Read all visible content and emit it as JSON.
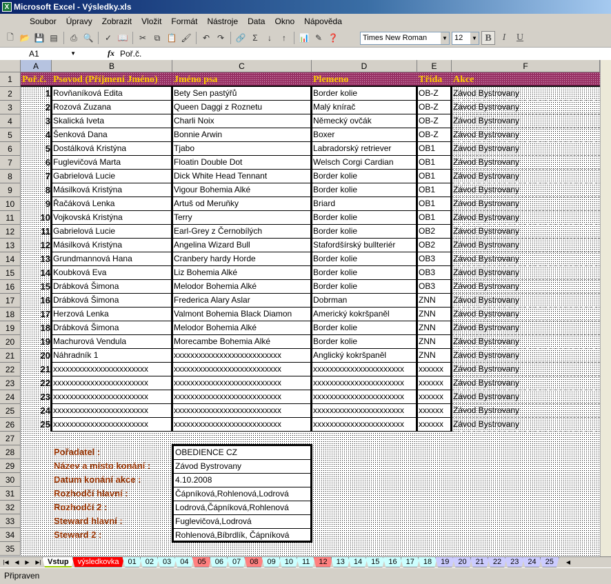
{
  "window": {
    "title": "Microsoft Excel - Výsledky.xls"
  },
  "menu": [
    "Soubor",
    "Úpravy",
    "Zobrazit",
    "Vložit",
    "Formát",
    "Nástroje",
    "Data",
    "Okno",
    "Nápověda"
  ],
  "toolbar": {
    "font": "Times New Roman",
    "size": "12",
    "bold": "B",
    "italic": "I",
    "underline": "U",
    "sigma": "Σ"
  },
  "formula": {
    "cell": "A1",
    "fx": "fx",
    "value": "Poř.č."
  },
  "columns": [
    "A",
    "B",
    "C",
    "D",
    "E",
    "F"
  ],
  "header": [
    "Poř.č.",
    "Psovod (Příjmení Jméno)",
    "Jméno psa",
    "Plemeno",
    "Třída",
    "Akce"
  ],
  "rows": [
    [
      "1",
      "Rovňaníková Edita",
      "Bety Sen pastýřů",
      "Border kolie",
      "OB-Z",
      "Závod Bystrovany"
    ],
    [
      "2",
      "Rozová Zuzana",
      "Queen Daggi z Roznetu",
      "Malý knírač",
      "OB-Z",
      "Závod Bystrovany"
    ],
    [
      "3",
      "Skalická Iveta",
      "Charli Noix",
      "Německý ovčák",
      "OB-Z",
      "Závod Bystrovany"
    ],
    [
      "4",
      "Šenková Dana",
      "Bonnie Arwin",
      "Boxer",
      "OB-Z",
      "Závod Bystrovany"
    ],
    [
      "5",
      "Dostálková Kristýna",
      "Tjabo",
      "Labradorský retriever",
      "OB1",
      "Závod Bystrovany"
    ],
    [
      "6",
      "Fuglevičová Marta",
      "Floatin Double Dot",
      "Welsch Corgi Cardian",
      "OB1",
      "Závod Bystrovany"
    ],
    [
      "7",
      "Gabrielová Lucie",
      "Dick White Head Tennant",
      "Border kolie",
      "OB1",
      "Závod Bystrovany"
    ],
    [
      "8",
      "Másilková Kristýna",
      "Vigour Bohemia Alké",
      "Border kolie",
      "OB1",
      "Závod Bystrovany"
    ],
    [
      "9",
      "Řačáková Lenka",
      "Artuš od Meruňky",
      "Briard",
      "OB1",
      "Závod Bystrovany"
    ],
    [
      "10",
      "Vojkovská Kristýna",
      "Terry",
      "Border kolie",
      "OB1",
      "Závod Bystrovany"
    ],
    [
      "11",
      "Gabrielová Lucie",
      "Earl-Grey z Černobílých",
      "Border kolie",
      "OB2",
      "Závod Bystrovany"
    ],
    [
      "12",
      "Másilková Kristýna",
      "Angelina Wizard Bull",
      "Stafordšírský bullteriér",
      "OB2",
      "Závod Bystrovany"
    ],
    [
      "13",
      "Grundmannová Hana",
      "Cranbery hardy Horde",
      "Border kolie",
      "OB3",
      "Závod Bystrovany"
    ],
    [
      "14",
      "Koubková Eva",
      "Liz Bohemia Alké",
      "Border kolie",
      "OB3",
      "Závod Bystrovany"
    ],
    [
      "15",
      "Drábková Šimona",
      "Melodor Bohemia Alké",
      "Border kolie",
      "OB3",
      "Závod Bystrovany"
    ],
    [
      "16",
      "Drábková Šimona",
      "Frederica Alary Aslar",
      "Dobrman",
      "ZNN",
      "Závod Bystrovany"
    ],
    [
      "17",
      "Herzová Lenka",
      "Valmont Bohemia Black Diamon",
      "Americký kokršpaněl",
      "ZNN",
      "Závod Bystrovany"
    ],
    [
      "18",
      "Drábková Šimona",
      "Melodor Bohemia Alké",
      "Border kolie",
      "ZNN",
      "Závod Bystrovany"
    ],
    [
      "19",
      "Machurová Vendula",
      "Morecambe Bohemia Alké",
      "Border kolie",
      "ZNN",
      "Závod Bystrovany"
    ],
    [
      "20",
      "Náhradník 1",
      "xxxxxxxxxxxxxxxxxxxxxxxxxx",
      "Anglický kokršpaněl",
      "ZNN",
      "Závod Bystrovany"
    ],
    [
      "21",
      "xxxxxxxxxxxxxxxxxxxxxxx",
      "xxxxxxxxxxxxxxxxxxxxxxxxxx",
      "xxxxxxxxxxxxxxxxxxxxxx",
      "xxxxxx",
      "Závod Bystrovany"
    ],
    [
      "22",
      "xxxxxxxxxxxxxxxxxxxxxxx",
      "xxxxxxxxxxxxxxxxxxxxxxxxxx",
      "xxxxxxxxxxxxxxxxxxxxxx",
      "xxxxxx",
      "Závod Bystrovany"
    ],
    [
      "23",
      "xxxxxxxxxxxxxxxxxxxxxxx",
      "xxxxxxxxxxxxxxxxxxxxxxxxxx",
      "xxxxxxxxxxxxxxxxxxxxxx",
      "xxxxxx",
      "Závod Bystrovany"
    ],
    [
      "24",
      "xxxxxxxxxxxxxxxxxxxxxxx",
      "xxxxxxxxxxxxxxxxxxxxxxxxxx",
      "xxxxxxxxxxxxxxxxxxxxxx",
      "xxxxxx",
      "Závod Bystrovany"
    ],
    [
      "25",
      "xxxxxxxxxxxxxxxxxxxxxxx",
      "xxxxxxxxxxxxxxxxxxxxxxxxxx",
      "xxxxxxxxxxxxxxxxxxxxxx",
      "xxxxxx",
      "Závod Bystrovany"
    ]
  ],
  "info": [
    {
      "label": "Pořadatel :",
      "value": "OBEDIENCE CZ"
    },
    {
      "label": "Název a místo konání :",
      "value": "Závod Bystrovany"
    },
    {
      "label": "Datum konání akce :",
      "value": "4.10.2008"
    },
    {
      "label": "Rozhodčí hlavní :",
      "value": "Čápníková,Rohlenová,Lodrová"
    },
    {
      "label": "Rozhodčí 2 :",
      "value": "Lodrová,Čápníková,Rohlenová"
    },
    {
      "label": "Steward hlavní :",
      "value": "Fuglevičová,Lodrová"
    },
    {
      "label": "Steward 2 :",
      "value": "Rohlenová,Bíbrdlík, Čápníková"
    }
  ],
  "tabs": [
    {
      "label": "Vstup",
      "color": "#ffffff",
      "active": true
    },
    {
      "label": "výsledkovka",
      "color": "#ff0000"
    },
    {
      "label": "01",
      "color": "#ccffff"
    },
    {
      "label": "02",
      "color": "#ccffff"
    },
    {
      "label": "03",
      "color": "#ccffff"
    },
    {
      "label": "04",
      "color": "#ccffff"
    },
    {
      "label": "05",
      "color": "#ff8080"
    },
    {
      "label": "06",
      "color": "#ccffff"
    },
    {
      "label": "07",
      "color": "#ccffff"
    },
    {
      "label": "08",
      "color": "#ff8080"
    },
    {
      "label": "09",
      "color": "#ccffff"
    },
    {
      "label": "10",
      "color": "#ccffff"
    },
    {
      "label": "11",
      "color": "#ccffff"
    },
    {
      "label": "12",
      "color": "#ff8080"
    },
    {
      "label": "13",
      "color": "#ccffff"
    },
    {
      "label": "14",
      "color": "#ccffff"
    },
    {
      "label": "15",
      "color": "#ccffff"
    },
    {
      "label": "16",
      "color": "#ccffff"
    },
    {
      "label": "17",
      "color": "#ccffff"
    },
    {
      "label": "18",
      "color": "#ccffff"
    },
    {
      "label": "19",
      "color": "#ccccff"
    },
    {
      "label": "20",
      "color": "#ccccff"
    },
    {
      "label": "21",
      "color": "#ccccff"
    },
    {
      "label": "22",
      "color": "#ccccff"
    },
    {
      "label": "23",
      "color": "#ccccff"
    },
    {
      "label": "24",
      "color": "#ccccff"
    },
    {
      "label": "25",
      "color": "#ccccff"
    }
  ],
  "status": "Připraven"
}
